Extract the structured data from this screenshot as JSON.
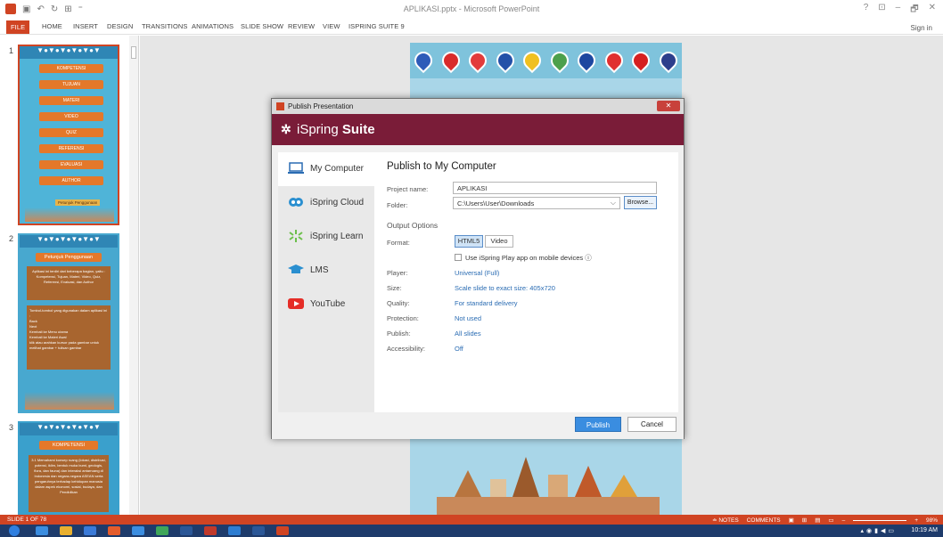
{
  "window": {
    "title": "APLIKASI.pptx - Microsoft PowerPoint",
    "controls": [
      "?",
      "⊡",
      "–",
      "🗗",
      "✕"
    ],
    "sign_in": "Sign in"
  },
  "ribbon": {
    "tabs": [
      "FILE",
      "HOME",
      "INSERT",
      "DESIGN",
      "TRANSITIONS",
      "ANIMATIONS",
      "SLIDE SHOW",
      "REVIEW",
      "VIEW",
      "ISPRING SUITE 9"
    ]
  },
  "thumbnails": {
    "items": [
      {
        "number": "1",
        "selected": true,
        "bg": "#4fb4d8"
      },
      {
        "number": "2",
        "selected": false,
        "bg": "#48a8cf"
      },
      {
        "number": "3",
        "selected": false,
        "bg": "#3aa0cc"
      }
    ],
    "slide1": {
      "buttons": [
        "KOMPETENSI",
        "TUJUAN",
        "MATERI",
        "VIDEO",
        "QUIZ",
        "REFERENSI",
        "EVALUASI",
        "AUTHOR"
      ],
      "footer": "Petunjuk Penggunaan"
    },
    "slide2": {
      "title": "Petunjuk Penggunaan",
      "text": "Aplikasi ini terdiri dari beberapa bagian, yaitu : Kompetensi, Tujuan, Materi, Video, Quiz, Referensi, Evaluasi, dan Author",
      "nav_title": "Tombol-tombol yang digunakan dalam aplikasi ini :",
      "nav_items": [
        "Back",
        "Next",
        "Kembali ke Menu utama",
        "Kembali ke Materi Awal",
        "klik atau arahkan kursor pada gambar untuk melihat gambar + tulisan gambar"
      ]
    },
    "slide3": {
      "title": "KOMPETENSI",
      "text": "3.1 Memahami konsep ruang (lokasi, distribusi, potensi, iklim, bentuk muka bumi, geologis, flora, dan fauna) dan interaksi antarruang di Indonesia dan negara-negara ASEAN serta pengaruhnya terhadap kehidupan manusia dalam aspek ekonomi, sosial, budaya, dan Pendidikan"
    }
  },
  "dialog": {
    "title": "Publish Presentation",
    "brand_logo": "✲",
    "brand_light": "iSpring",
    "brand_bold": "Suite",
    "close": "✕",
    "sidebar": [
      {
        "label": "My Computer",
        "selected": true
      },
      {
        "label": "iSpring Cloud",
        "selected": false
      },
      {
        "label": "iSpring Learn",
        "selected": false
      },
      {
        "label": "LMS",
        "selected": false
      },
      {
        "label": "YouTube",
        "selected": false
      }
    ],
    "heading": "Publish to My Computer",
    "project_name_label": "Project name:",
    "project_name_value": "APLIKASI",
    "folder_label": "Folder:",
    "folder_value": "C:\\Users\\User\\Downloads",
    "browse_label": "Browse...",
    "output_options": "Output Options",
    "format_label": "Format:",
    "format_options": [
      "HTML5",
      "Video"
    ],
    "format_selected": "HTML5",
    "mobile_checkbox": "Use iSpring Play app on mobile devices ⓘ",
    "mobile_checked": false,
    "rows": [
      {
        "label": "Player:",
        "value": "Universal (Full)"
      },
      {
        "label": "Size:",
        "value": "Scale slide to exact size: 405x720"
      },
      {
        "label": "Quality:",
        "value": "For standard delivery"
      },
      {
        "label": "Protection:",
        "value": "Not used"
      },
      {
        "label": "Publish:",
        "value": "All slides"
      },
      {
        "label": "Accessibility:",
        "value": "Off"
      }
    ],
    "publish_button": "Publish",
    "cancel_button": "Cancel"
  },
  "statusbar": {
    "slide_indicator": "SLIDE 1 OF 78",
    "notes": "≐ NOTES",
    "comments": "COMMENTS",
    "zoom": "98%"
  },
  "taskbar": {
    "clock": "10:19 AM"
  },
  "colors": {
    "accent": "#d04423",
    "brand": "#7a1c38",
    "link": "#2a6cb3",
    "publish": "#3a8de0"
  }
}
